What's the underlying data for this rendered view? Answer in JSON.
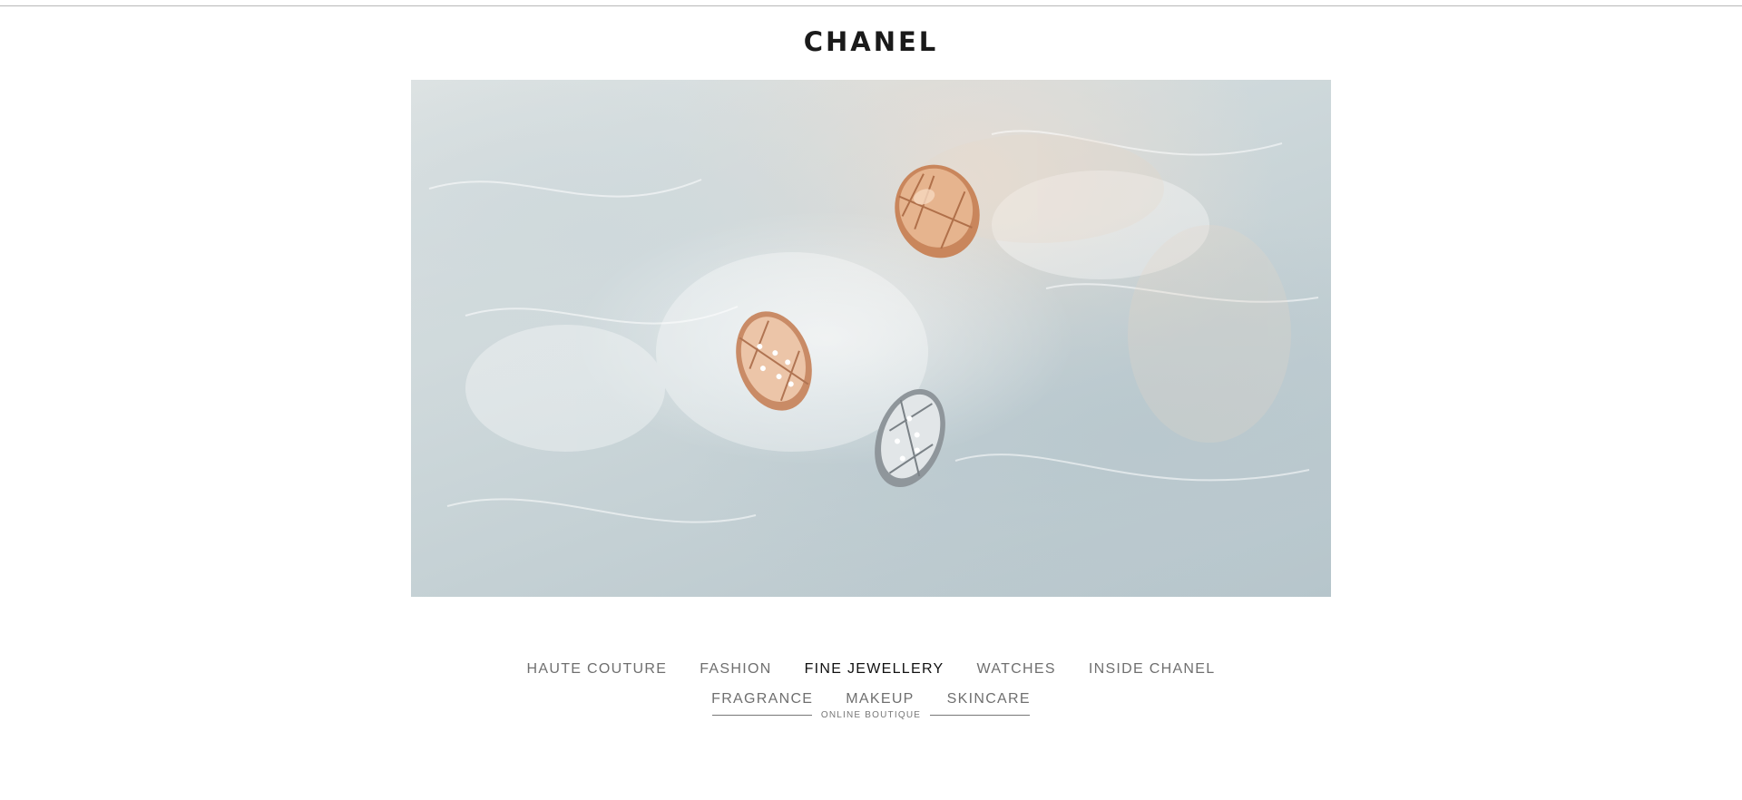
{
  "header": {
    "logo": "CHANEL"
  },
  "hero": {
    "image_name": "coco-crush-rings-on-ice"
  },
  "nav": {
    "row1": [
      {
        "label": "HAUTE COUTURE",
        "active": false
      },
      {
        "label": "FASHION",
        "active": false
      },
      {
        "label": "FINE JEWELLERY",
        "active": true
      },
      {
        "label": "WATCHES",
        "active": false
      },
      {
        "label": "INSIDE CHANEL",
        "active": false
      }
    ],
    "row2": [
      {
        "label": "FRAGRANCE",
        "active": false
      },
      {
        "label": "MAKEUP",
        "active": false
      },
      {
        "label": "SKINCARE",
        "active": false
      }
    ],
    "boutique_label": "ONLINE BOUTIQUE"
  },
  "colors": {
    "active_nav": "#111111",
    "inactive_nav": "#6f6f6f",
    "rose_gold": "#d6a07a",
    "white_gold": "#d9dde0"
  }
}
